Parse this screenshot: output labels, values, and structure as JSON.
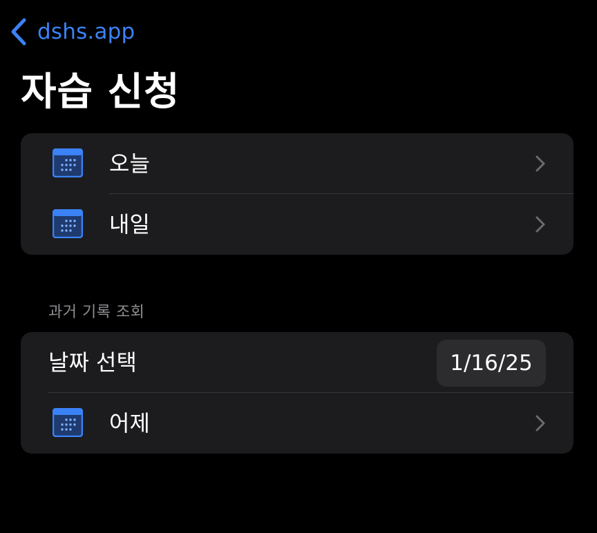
{
  "nav": {
    "back_label": "dshs.app"
  },
  "title": "자습 신청",
  "quick_list": {
    "items": [
      {
        "label": "오늘",
        "icon": "calendar-icon"
      },
      {
        "label": "내일",
        "icon": "calendar-icon"
      }
    ]
  },
  "history": {
    "header": "과거 기록 조회",
    "date_select_label": "날짜 선택",
    "date_value": "1/16/25",
    "items": [
      {
        "label": "어제",
        "icon": "calendar-icon"
      }
    ]
  },
  "colors": {
    "accent": "#3b82f6",
    "background": "#000000",
    "card": "#1c1c1e",
    "secondary_text": "#8e8e93"
  }
}
